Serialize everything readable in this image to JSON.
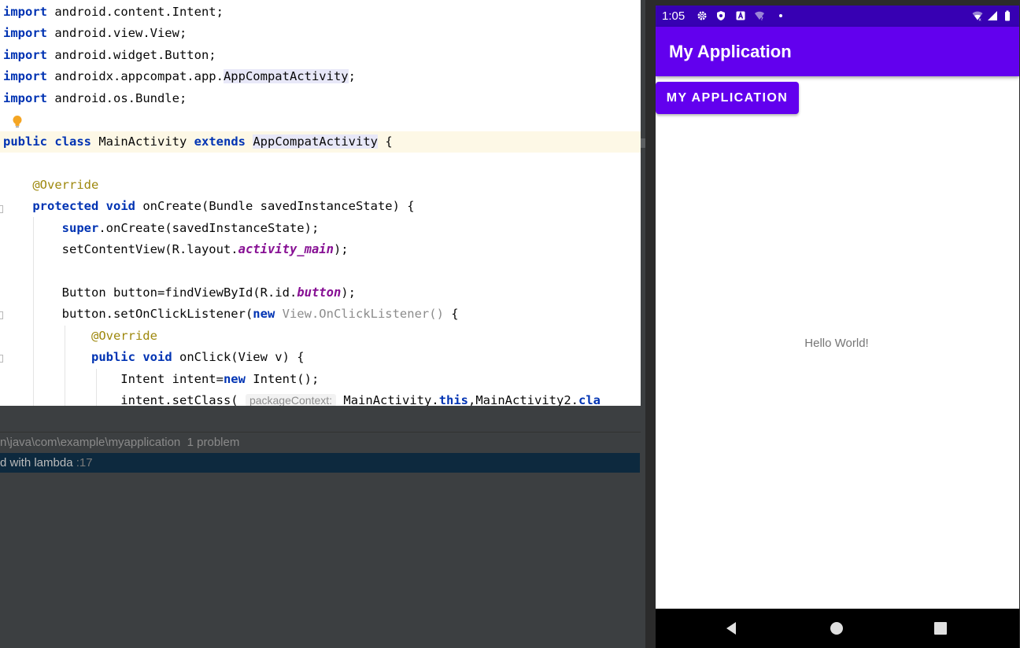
{
  "editor": {
    "lines": [
      {
        "id": "l1",
        "segments": [
          {
            "t": "import",
            "c": "kw"
          },
          {
            "t": " android.content.Intent;"
          }
        ]
      },
      {
        "id": "l2",
        "segments": [
          {
            "t": "import",
            "c": "kw"
          },
          {
            "t": " android.view.View;"
          }
        ]
      },
      {
        "id": "l3",
        "segments": [
          {
            "t": "import",
            "c": "kw"
          },
          {
            "t": " android.widget.Button;"
          }
        ]
      },
      {
        "id": "l4",
        "segments": [
          {
            "t": "import",
            "c": "kw"
          },
          {
            "t": " androidx.appcompat.app."
          },
          {
            "t": "AppCompatActivity",
            "c": "cls-hl"
          },
          {
            "t": ";"
          }
        ]
      },
      {
        "id": "l5",
        "segments": [
          {
            "t": "import",
            "c": "kw"
          },
          {
            "t": " android.os.Bundle;"
          }
        ]
      },
      {
        "id": "l6",
        "segments": []
      },
      {
        "id": "l7",
        "segments": [
          {
            "t": "public",
            "c": "kw"
          },
          {
            "t": " "
          },
          {
            "t": "class",
            "c": "kw"
          },
          {
            "t": " MainActivity "
          },
          {
            "t": "extends",
            "c": "kw"
          },
          {
            "t": " "
          },
          {
            "t": "AppCompatActivity",
            "c": "cls-hl"
          },
          {
            "t": " {"
          }
        ]
      },
      {
        "id": "l8",
        "segments": []
      },
      {
        "id": "l9",
        "segments": [
          {
            "t": "    "
          },
          {
            "t": "@Override",
            "c": "ann"
          }
        ]
      },
      {
        "id": "l10",
        "segments": [
          {
            "t": "    "
          },
          {
            "t": "protected",
            "c": "kw"
          },
          {
            "t": " "
          },
          {
            "t": "void",
            "c": "kw"
          },
          {
            "t": " onCreate(Bundle savedInstanceState) {"
          }
        ]
      },
      {
        "id": "l11",
        "segments": [
          {
            "t": "        "
          },
          {
            "t": "super",
            "c": "kw"
          },
          {
            "t": ".onCreate(savedInstanceState);"
          }
        ]
      },
      {
        "id": "l12",
        "segments": [
          {
            "t": "        setContentView(R.layout."
          },
          {
            "t": "activity_main",
            "c": "fld"
          },
          {
            "t": ");"
          }
        ]
      },
      {
        "id": "l13",
        "segments": []
      },
      {
        "id": "l14",
        "segments": [
          {
            "t": "        Button button=findViewById(R.id."
          },
          {
            "t": "button",
            "c": "fld"
          },
          {
            "t": ");"
          }
        ]
      },
      {
        "id": "l15",
        "segments": [
          {
            "t": "        button.setOnClickListener("
          },
          {
            "t": "new",
            "c": "kw"
          },
          {
            "t": " "
          },
          {
            "t": "View.OnClickListener()",
            "c": "gray"
          },
          {
            "t": " {"
          }
        ]
      },
      {
        "id": "l16",
        "segments": [
          {
            "t": "            "
          },
          {
            "t": "@Override",
            "c": "ann"
          }
        ]
      },
      {
        "id": "l17",
        "segments": [
          {
            "t": "            "
          },
          {
            "t": "public",
            "c": "kw"
          },
          {
            "t": " "
          },
          {
            "t": "void",
            "c": "kw"
          },
          {
            "t": " onClick(View v) {"
          }
        ]
      },
      {
        "id": "l18",
        "segments": [
          {
            "t": "                Intent intent="
          },
          {
            "t": "new",
            "c": "kw"
          },
          {
            "t": " Intent();"
          }
        ]
      },
      {
        "id": "l19",
        "segments": [
          {
            "t": "                intent.setClass( "
          },
          {
            "t": "packageContext:",
            "c": "hint"
          },
          {
            "t": " MainActivity."
          },
          {
            "t": "this",
            "c": "kw"
          },
          {
            "t": ",MainActivity2."
          },
          {
            "t": "cla",
            "c": "kw"
          }
        ]
      }
    ]
  },
  "problems": {
    "path": "n\\java\\com\\example\\myapplication",
    "count": "1 problem",
    "row_text": "d with lambda",
    "row_line": ":17"
  },
  "phone": {
    "status": {
      "time": "1:05"
    },
    "app_title": "My Application",
    "button_label": "MY APPLICATION",
    "hello_text": "Hello World!",
    "colors": {
      "primary": "#6200ee",
      "primary_dark": "#3700b3"
    }
  }
}
